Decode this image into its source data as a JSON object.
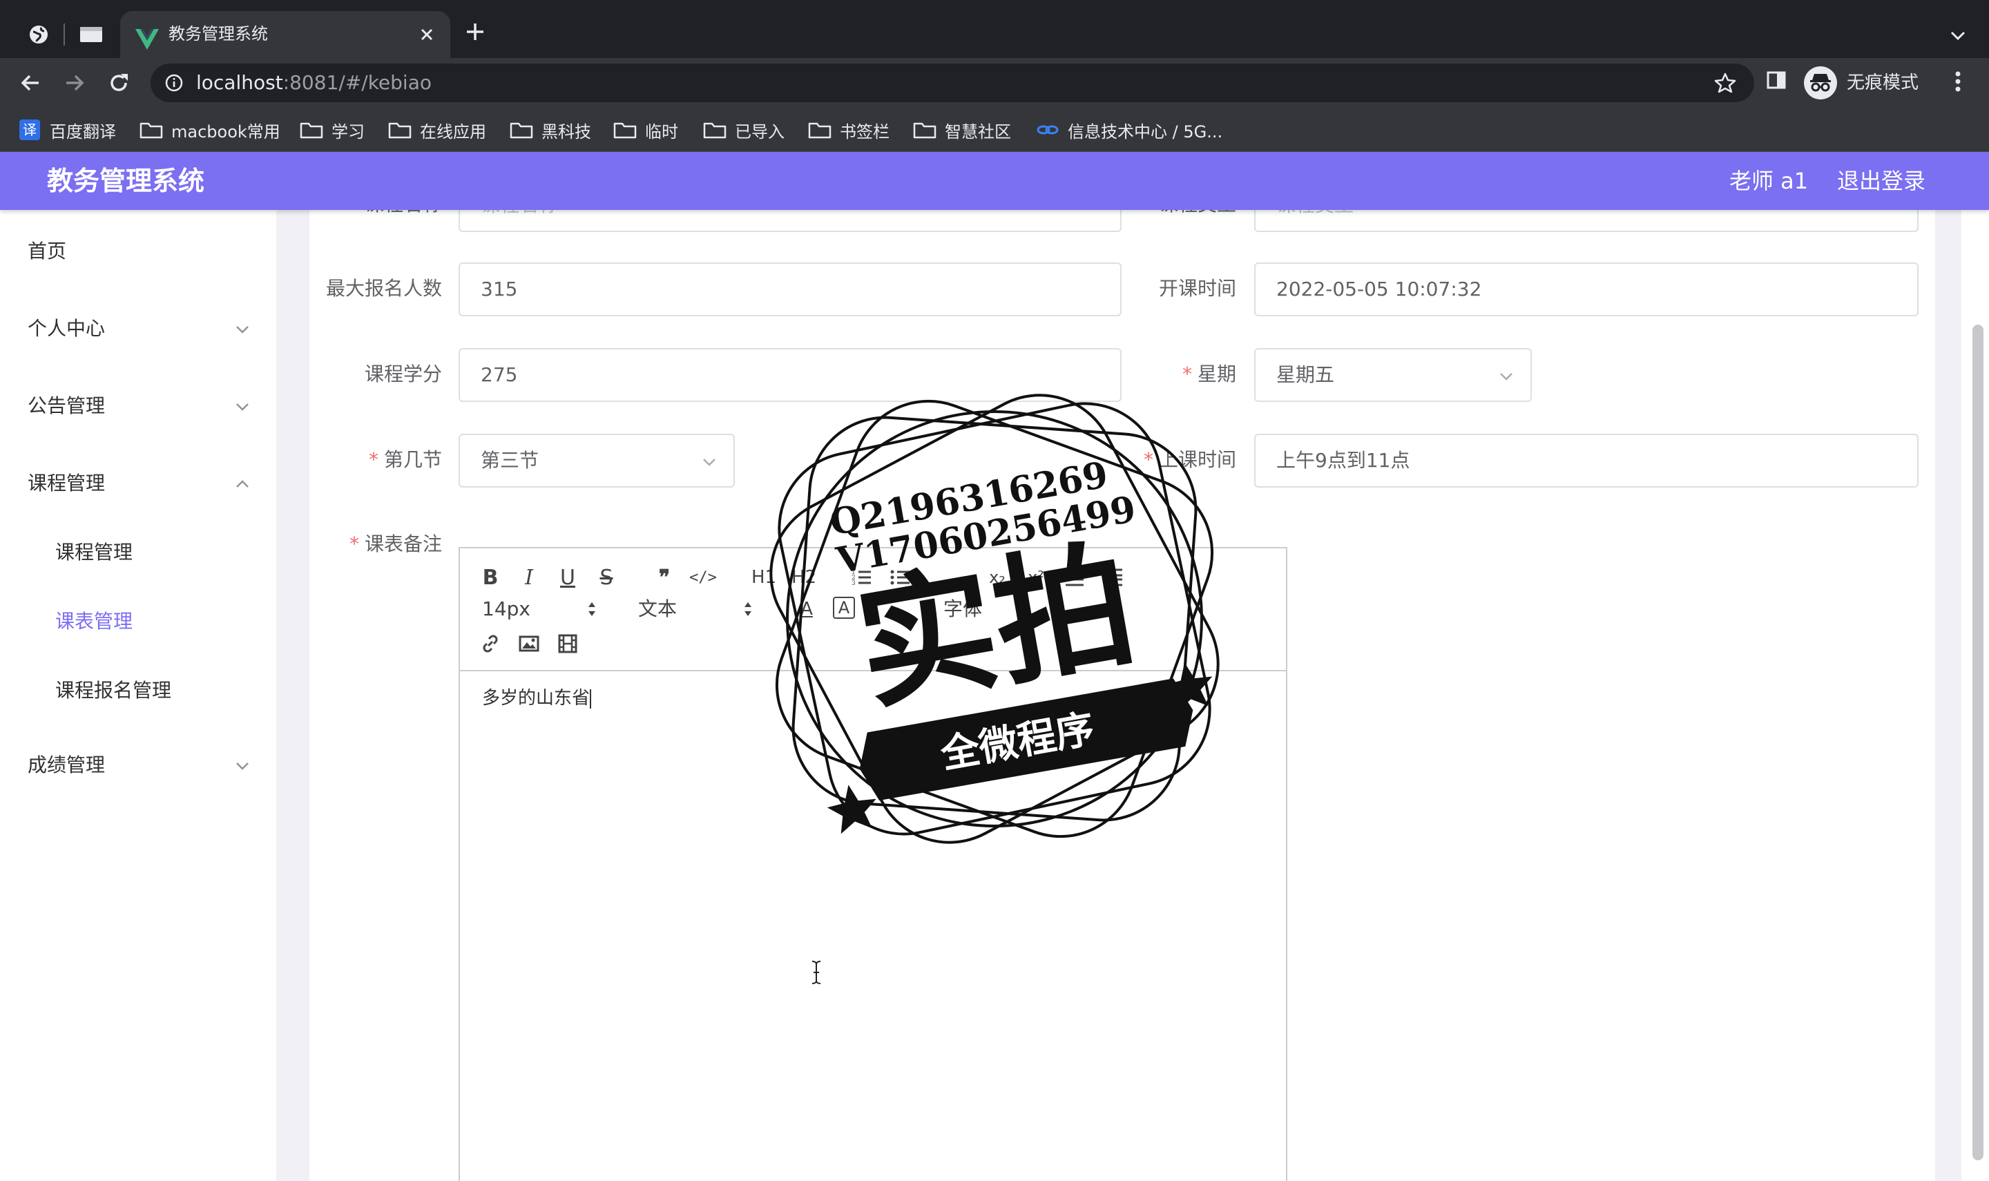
{
  "browser": {
    "tab_title": "教务管理系统",
    "url_host": "localhost",
    "url_rest": ":8081/#/kebiao",
    "incognito_label": "无痕模式",
    "bookmarks": [
      {
        "label": "百度翻译",
        "icon": "translate-icon",
        "badge": "译"
      },
      {
        "label": "macbook常用",
        "icon": "folder-icon"
      },
      {
        "label": "学习",
        "icon": "folder-icon"
      },
      {
        "label": "在线应用",
        "icon": "folder-icon"
      },
      {
        "label": "黑科技",
        "icon": "folder-icon"
      },
      {
        "label": "临时",
        "icon": "folder-icon"
      },
      {
        "label": "已导入",
        "icon": "folder-icon"
      },
      {
        "label": "书签栏",
        "icon": "folder-icon"
      },
      {
        "label": "智慧社区",
        "icon": "folder-icon"
      },
      {
        "label": "信息技术中心 / 5G...",
        "icon": "link-icon"
      }
    ]
  },
  "app": {
    "title": "教务管理系统",
    "user": "老师 a1",
    "logout": "退出登录",
    "accent": "#7b6ff2"
  },
  "sidebar": {
    "items": [
      {
        "label": "首页"
      },
      {
        "label": "个人中心"
      },
      {
        "label": "公告管理"
      },
      {
        "label": "课程管理"
      },
      {
        "label": "成绩管理"
      }
    ],
    "sub_items": [
      {
        "label": "课程管理"
      },
      {
        "label": "课表管理",
        "active": true
      },
      {
        "label": "课程报名管理"
      }
    ]
  },
  "form": {
    "course_name": {
      "label": "课程名称",
      "placeholder": "课程名称"
    },
    "course_type": {
      "label": "课程类型",
      "placeholder": "课程类型"
    },
    "max_enroll": {
      "label": "最大报名人数",
      "value": "315"
    },
    "start_time": {
      "label": "开课时间",
      "value": "2022-05-05 10:07:32"
    },
    "credit": {
      "label": "课程学分",
      "value": "275"
    },
    "weekday": {
      "label": "星期",
      "value": "星期五"
    },
    "section": {
      "label": "第几节",
      "value": "第三节"
    },
    "class_time": {
      "label": "上课时间",
      "value": "上午9点到11点"
    },
    "remark": {
      "label": "课表备注"
    }
  },
  "editor": {
    "font_size": "14px",
    "paragraph": "文本",
    "font_family": "字体",
    "h1": "H1",
    "h2": "H2",
    "content": "多岁的山东省"
  },
  "watermark": {
    "line1": "Q2196316269",
    "line2": "V17060256499",
    "main": "实拍",
    "banner": "全微程序"
  }
}
